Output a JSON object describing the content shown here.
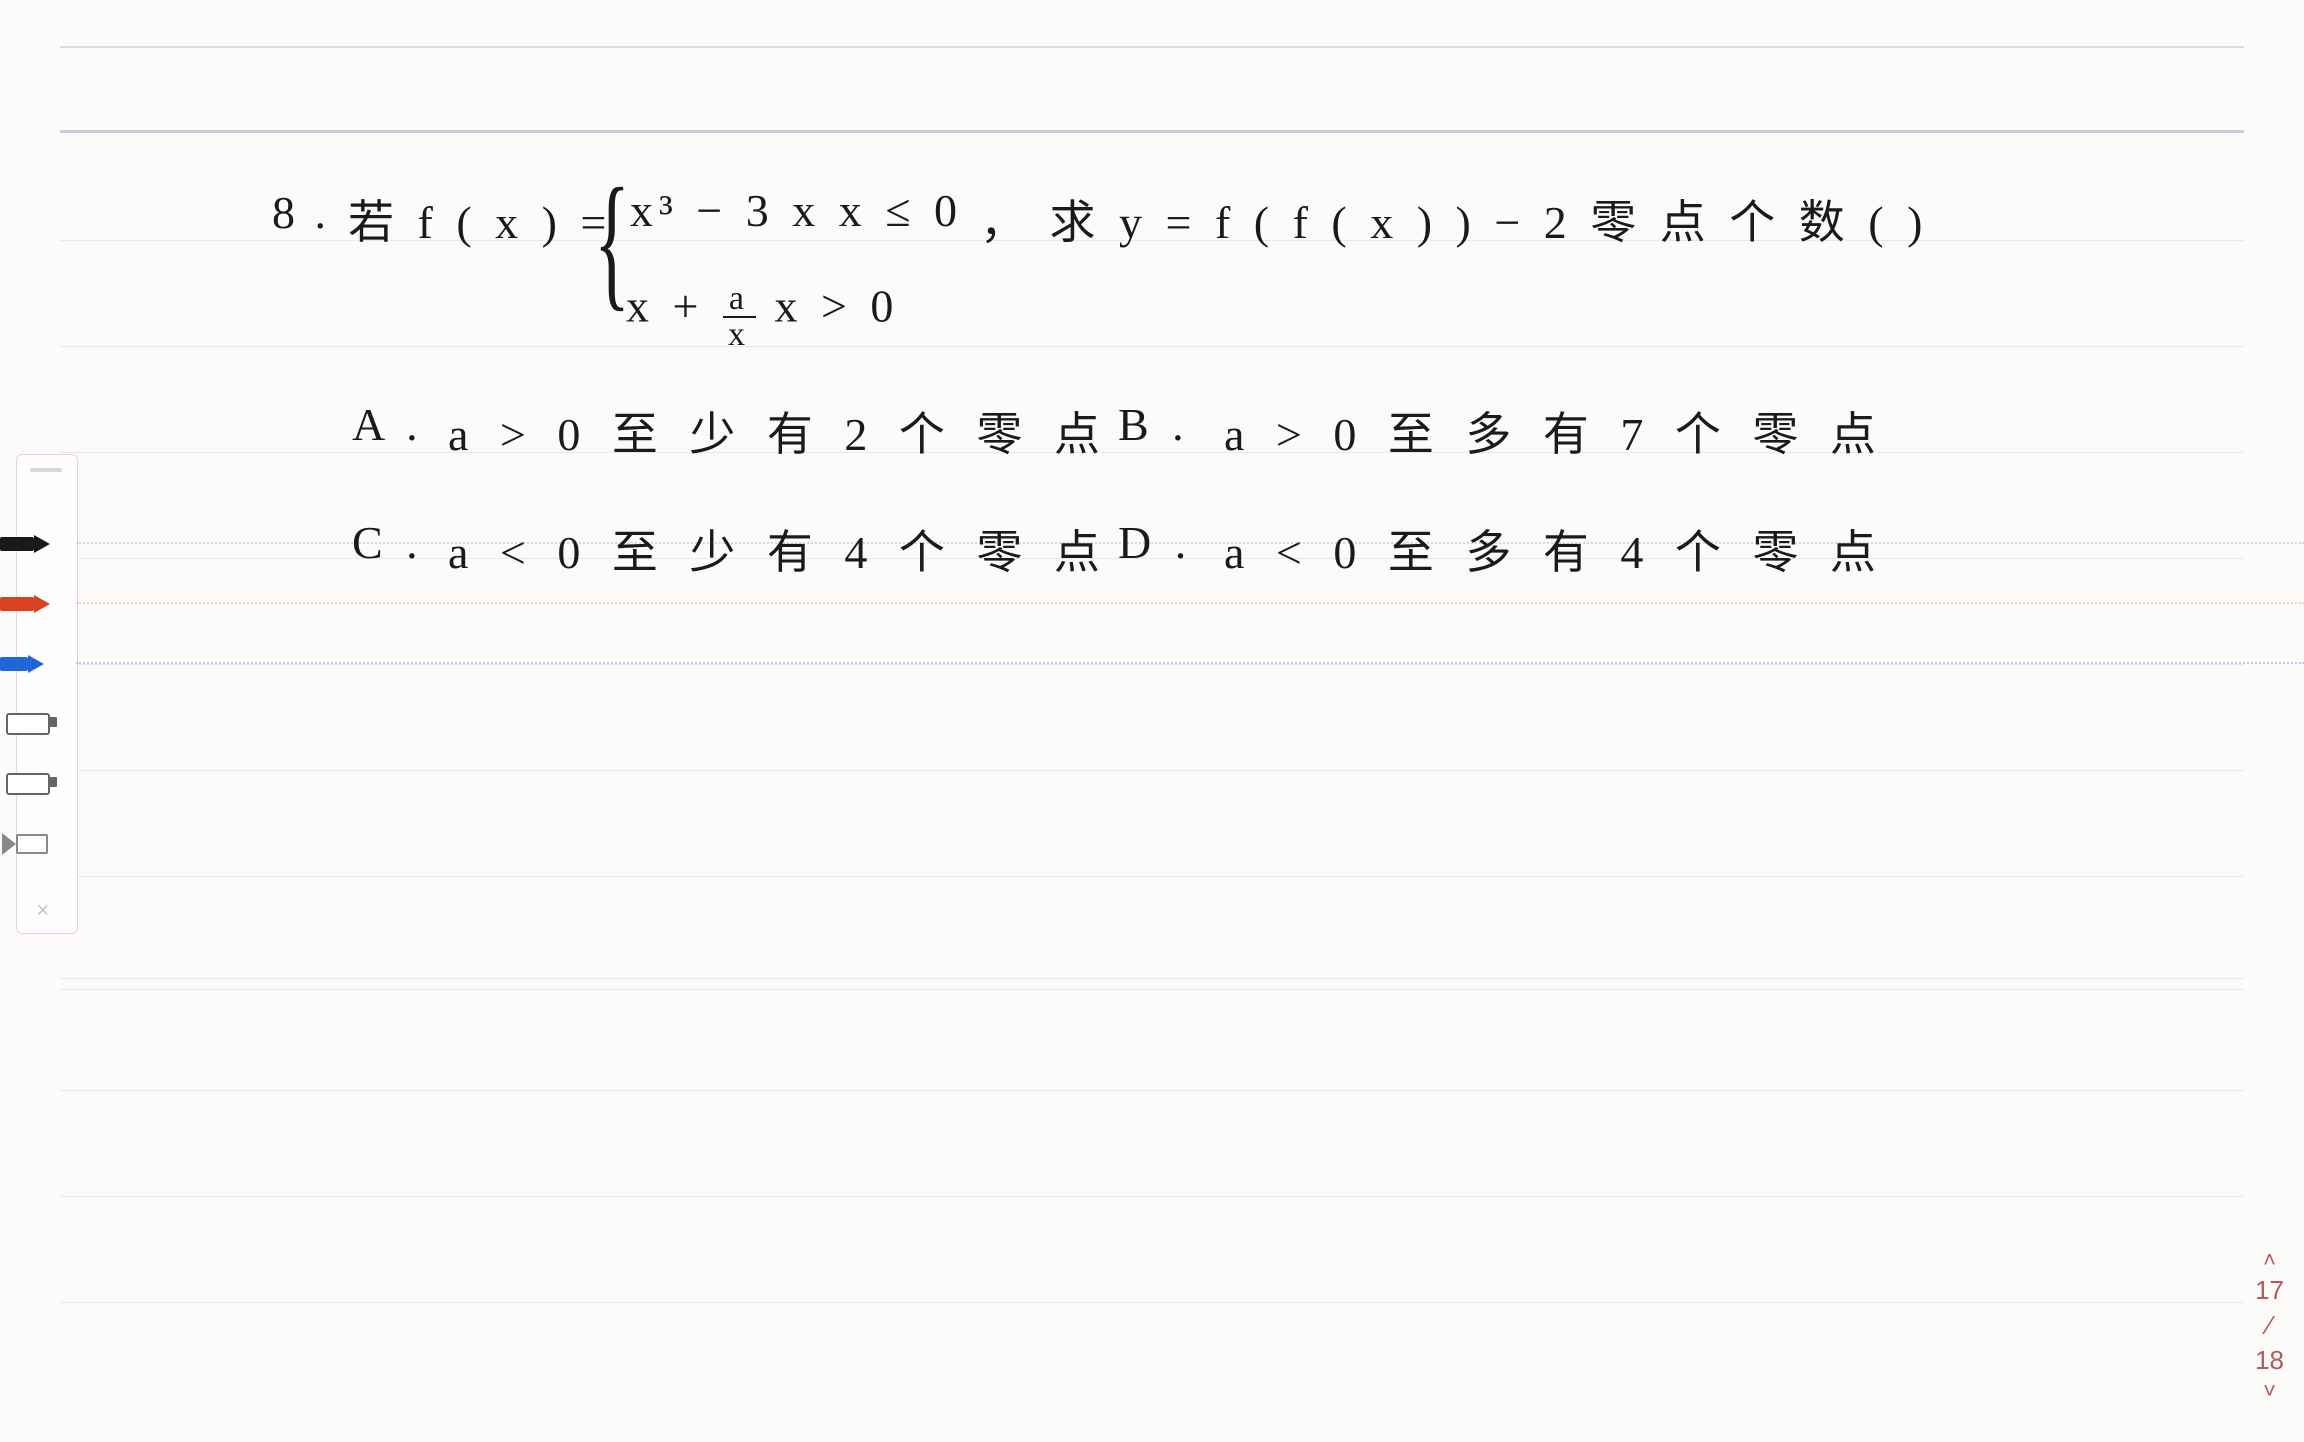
{
  "problem": {
    "number": "8 .",
    "prefix": "若  f ( x )  =",
    "case1": "x³ − 3 x     x ≤ 0",
    "case2_left": "x +",
    "case2_frac_num": "a",
    "case2_frac_den": "x",
    "case2_right": "     x > 0",
    "tail": "，  求   y = f ( f ( x ) ) − 2   零 点 个 数  (       )"
  },
  "options": {
    "A": {
      "label": "A .",
      "text": "a > 0   至 少 有 2 个 零 点"
    },
    "B": {
      "label": "B .",
      "text": "a > 0   至 多 有 7 个 零 点"
    },
    "C": {
      "label": "C .",
      "text": "a < 0   至 少 有 4 个 零 点"
    },
    "D": {
      "label": "D .",
      "text": "a < 0   至 多 有 4 个 零 点"
    }
  },
  "tools": {
    "black": "black-pen",
    "red": "red-pen",
    "blue": "blue-pen",
    "eraser1": "eraser",
    "eraser2": "eraser-alt",
    "marker": "marker",
    "close": "×"
  },
  "pager": {
    "up": "˄",
    "current": "17",
    "sep": "⁄",
    "total": "18",
    "down": "˅"
  }
}
